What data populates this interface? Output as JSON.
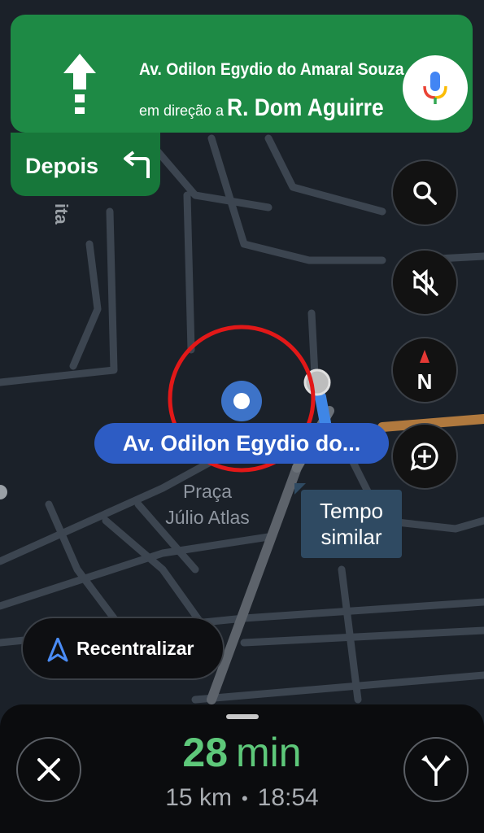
{
  "nav_card": {
    "street": "Av. Odilon Egydio do Amaral Souza",
    "toward_prefix": "em direção a",
    "destination": "R. Dom Aguirre",
    "color": "#1e8a45"
  },
  "then_card": {
    "label": "Depois"
  },
  "map": {
    "road_label": "Av. Odilon Egydio do...",
    "place_line1": "Praça",
    "place_line2": "Júlio Atlas",
    "street_fragment": "ita",
    "tempo_line1": "Tempo",
    "tempo_line2": "similar"
  },
  "side_buttons": [
    "search-icon",
    "sound-off-icon",
    "compass-icon",
    "add-report-icon"
  ],
  "compass_letter": "N",
  "recenter": {
    "label": "Recentralizar"
  },
  "trip": {
    "eta_value": "28",
    "eta_unit": "min",
    "distance": "15 km",
    "separator": "•",
    "arrival": "18:54",
    "eta_color": "#5ec87a"
  }
}
